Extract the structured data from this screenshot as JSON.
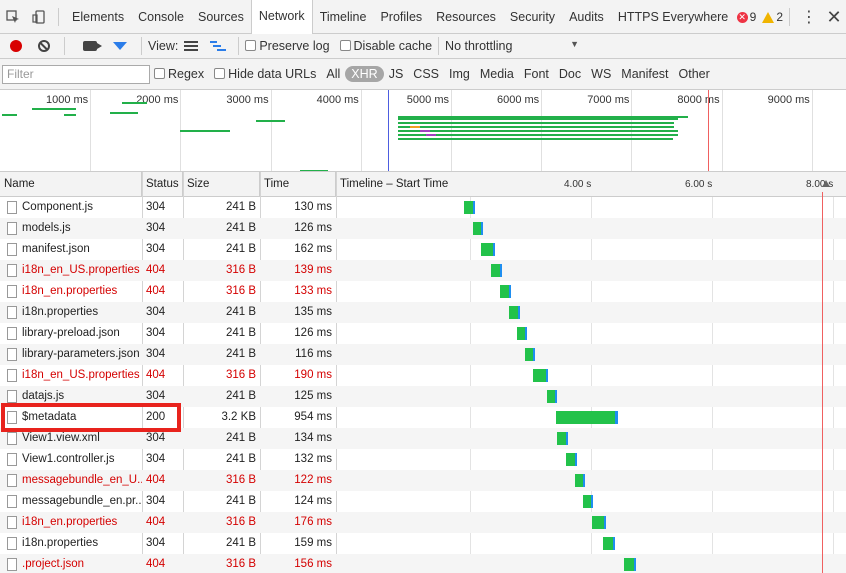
{
  "tabs": [
    "Elements",
    "Console",
    "Sources",
    "Network",
    "Timeline",
    "Profiles",
    "Resources",
    "Security",
    "Audits",
    "HTTPS Everywhere"
  ],
  "active_tab": "Network",
  "errors_count": "9",
  "warnings_count": "2",
  "toolbar": {
    "view_label": "View:",
    "preserve_log": "Preserve log",
    "disable_cache": "Disable cache",
    "throttling": "No throttling"
  },
  "filter": {
    "placeholder": "Filter",
    "regex": "Regex",
    "hide_data_urls": "Hide data URLs",
    "types": [
      "All",
      "XHR",
      "JS",
      "CSS",
      "Img",
      "Media",
      "Font",
      "Doc",
      "WS",
      "Manifest",
      "Other"
    ],
    "selected_type": "XHR"
  },
  "overview_ticks": [
    "1000 ms",
    "2000 ms",
    "3000 ms",
    "4000 ms",
    "5000 ms",
    "6000 ms",
    "7000 ms",
    "8000 ms",
    "9000 ms"
  ],
  "columns": {
    "name": "Name",
    "status": "Status",
    "size": "Size",
    "time": "Time",
    "timeline": "Timeline – Start Time"
  },
  "timeline_ticks": [
    "4.00 s",
    "6.00 s",
    "8.00 s"
  ],
  "rows": [
    {
      "name": "Component.js",
      "status": "304",
      "size": "241 B",
      "time": "130 ms",
      "error": false
    },
    {
      "name": "models.js",
      "status": "304",
      "size": "241 B",
      "time": "126 ms",
      "error": false
    },
    {
      "name": "manifest.json",
      "status": "304",
      "size": "241 B",
      "time": "162 ms",
      "error": false
    },
    {
      "name": "i18n_en_US.properties",
      "status": "404",
      "size": "316 B",
      "time": "139 ms",
      "error": true
    },
    {
      "name": "i18n_en.properties",
      "status": "404",
      "size": "316 B",
      "time": "133 ms",
      "error": true
    },
    {
      "name": "i18n.properties",
      "status": "304",
      "size": "241 B",
      "time": "135 ms",
      "error": false
    },
    {
      "name": "library-preload.json",
      "status": "304",
      "size": "241 B",
      "time": "126 ms",
      "error": false
    },
    {
      "name": "library-parameters.json",
      "status": "304",
      "size": "241 B",
      "time": "116 ms",
      "error": false
    },
    {
      "name": "i18n_en_US.properties",
      "status": "404",
      "size": "316 B",
      "time": "190 ms",
      "error": true
    },
    {
      "name": "datajs.js",
      "status": "304",
      "size": "241 B",
      "time": "125 ms",
      "error": false
    },
    {
      "name": "$metadata",
      "status": "200",
      "size": "3.2 KB",
      "time": "954 ms",
      "error": false
    },
    {
      "name": "View1.view.xml",
      "status": "304",
      "size": "241 B",
      "time": "134 ms",
      "error": false
    },
    {
      "name": "View1.controller.js",
      "status": "304",
      "size": "241 B",
      "time": "132 ms",
      "error": false
    },
    {
      "name": "messagebundle_en_U...",
      "status": "404",
      "size": "316 B",
      "time": "122 ms",
      "error": true
    },
    {
      "name": "messagebundle_en.pr...",
      "status": "304",
      "size": "241 B",
      "time": "124 ms",
      "error": false
    },
    {
      "name": "i18n_en.properties",
      "status": "404",
      "size": "316 B",
      "time": "176 ms",
      "error": true
    },
    {
      "name": "i18n.properties",
      "status": "304",
      "size": "241 B",
      "time": "159 ms",
      "error": false
    },
    {
      "name": ".project.json",
      "status": "404",
      "size": "316 B",
      "time": "156 ms",
      "error": true
    }
  ]
}
